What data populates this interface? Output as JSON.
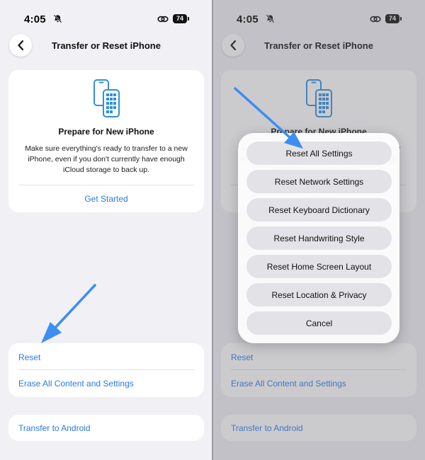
{
  "status_bar": {
    "time": "4:05",
    "battery": "74"
  },
  "nav": {
    "title": "Transfer or Reset iPhone"
  },
  "prepare": {
    "title": "Prepare for New iPhone",
    "body": "Make sure everything's ready to transfer to a new iPhone, even if you don't currently have enough iCloud storage to back up.",
    "action": "Get Started"
  },
  "reset_section": {
    "reset": "Reset",
    "erase": "Erase All Content and Settings"
  },
  "android": {
    "label": "Transfer to Android"
  },
  "reset_sheet": {
    "options": [
      "Reset All Settings",
      "Reset Network Settings",
      "Reset Keyboard Dictionary",
      "Reset Handwriting Style",
      "Reset Home Screen Layout",
      "Reset Location & Privacy"
    ],
    "cancel": "Cancel"
  },
  "colors": {
    "link": "#2a7ae2",
    "icon_accent": "#2f8fde",
    "arrow": "#3d8ef0",
    "background": "#f0f0f5"
  },
  "icons": {
    "back": "chevron-left-icon",
    "silent": "bell-slash-icon",
    "link": "link-icon",
    "prepare": "two-phones-icon",
    "annotation": "arrow-icon"
  }
}
